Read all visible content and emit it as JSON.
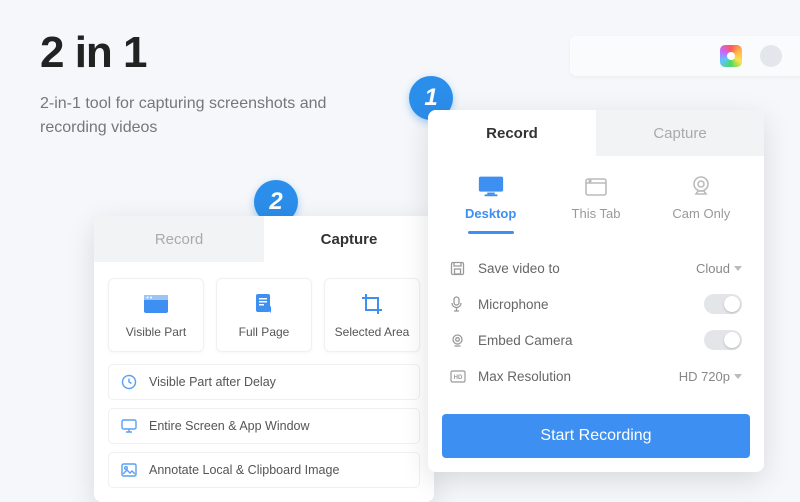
{
  "hero": {
    "title": "2 in 1",
    "subtitle": "2-in-1 tool for capturing screenshots and recording videos"
  },
  "badges": {
    "one": "1",
    "two": "2"
  },
  "recordPanel": {
    "tabs": {
      "record": "Record",
      "capture": "Capture"
    },
    "modes": {
      "desktop": "Desktop",
      "thisTab": "This Tab",
      "camOnly": "Cam Only"
    },
    "settings": {
      "saveTo": {
        "label": "Save video to",
        "value": "Cloud"
      },
      "microphone": {
        "label": "Microphone"
      },
      "embedCamera": {
        "label": "Embed Camera"
      },
      "maxRes": {
        "label": "Max Resolution",
        "value": "HD 720p"
      }
    },
    "startButton": "Start Recording"
  },
  "capturePanel": {
    "tabs": {
      "record": "Record",
      "capture": "Capture"
    },
    "cards": {
      "visiblePart": "Visible Part",
      "fullPage": "Full Page",
      "selectedArea": "Selected Area"
    },
    "list": {
      "afterDelay": "Visible Part after Delay",
      "entireScreen": "Entire Screen & App Window",
      "annotate": "Annotate Local & Clipboard Image"
    }
  }
}
